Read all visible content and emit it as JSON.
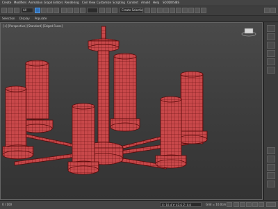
{
  "menubar": {
    "items": [
      "Create",
      "Modifiers",
      "Animation",
      "Graph Editors",
      "Rendering",
      "Civil View",
      "Customize",
      "Scripting",
      "Content",
      "Arnold",
      "Help",
      "SOODOSIBS"
    ]
  },
  "toolbar": {
    "selection_filter": "All",
    "named_selection_placeholder": "Create Selection Set"
  },
  "ribbon": {
    "tabs": [
      "Selection",
      "Display",
      "Populate"
    ]
  },
  "viewport": {
    "label": "[+] [Perspective] [Standard] [Edged Faces]",
    "colors": {
      "mesh_fill": "#c8484a",
      "mesh_wire": "#5a0a0a",
      "mesh_dark": "#a83638"
    }
  },
  "statusbar": {
    "frame_counter": "0 / 100",
    "coords": "X: 10.4  Y: 42.6  Z: 0.0",
    "grid": "Grid = 10.0cm",
    "add_time_tag": "Add Time Tag",
    "auto_key": "Auto Key",
    "selected": "Selected"
  }
}
